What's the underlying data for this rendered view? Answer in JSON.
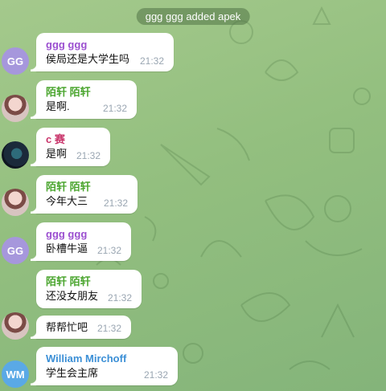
{
  "service_message": "ggg ggg added apek",
  "colors": {
    "purple_name": "#9b4fd0",
    "green_name": "#4aa52e",
    "pink_name": "#c9356b",
    "blue_name": "#3b8fd6"
  },
  "messages": [
    {
      "sender": "ggg ggg",
      "avatar": "GG",
      "text": "侯局还是大学生吗",
      "time": "21:32"
    },
    {
      "sender": "陌轩 陌轩",
      "avatar": "photo",
      "text": "是啊.",
      "time": "21:32"
    },
    {
      "sender": "c 赛",
      "avatar": "photo",
      "text": "是啊",
      "time": "21:32"
    },
    {
      "sender": "陌轩 陌轩",
      "avatar": "photo",
      "text": "今年大三",
      "time": "21:32"
    },
    {
      "sender": "ggg ggg",
      "avatar": "GG",
      "text": "卧槽牛逼",
      "time": "21:32"
    },
    {
      "sender": "陌轩 陌轩",
      "avatar": "photo",
      "text": "还没女朋友",
      "time": "21:32"
    },
    {
      "sender": "",
      "avatar": "photo",
      "text": "帮帮忙吧",
      "time": "21:32"
    },
    {
      "sender": "William Mirchoff",
      "avatar": "WM",
      "text": "学生会主席",
      "time": "21:32"
    }
  ]
}
